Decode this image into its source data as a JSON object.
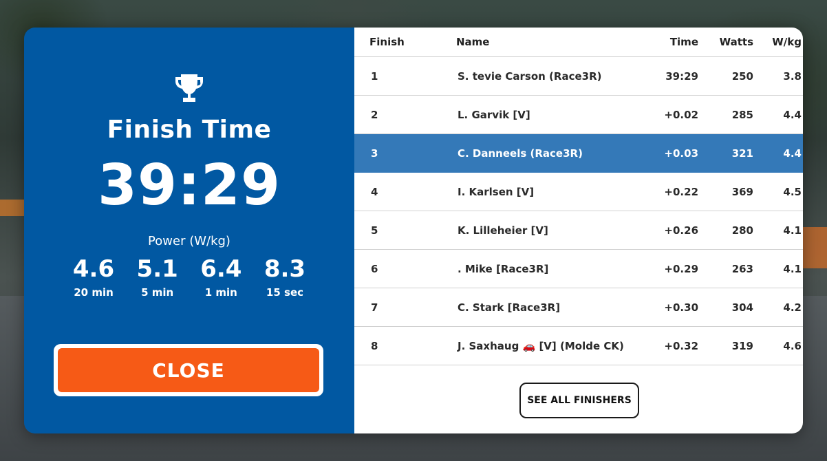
{
  "summary": {
    "title": "Finish Time",
    "time": "39:29",
    "power_label": "Power (W/kg)",
    "power": [
      {
        "value": "4.6",
        "period": "20 min"
      },
      {
        "value": "5.1",
        "period": "5 min"
      },
      {
        "value": "6.4",
        "period": "1 min"
      },
      {
        "value": "8.3",
        "period": "15 sec"
      }
    ],
    "close_label": "CLOSE"
  },
  "results": {
    "columns": {
      "finish": "Finish",
      "name": "Name",
      "time": "Time",
      "watts": "Watts",
      "wkg": "W/kg"
    },
    "rows": [
      {
        "finish": "1",
        "name": "S. tevie Carson (Race3R)",
        "time": "39:29",
        "watts": "250",
        "wkg": "3.8"
      },
      {
        "finish": "2",
        "name": "L. Garvik [V]",
        "time": "+0.02",
        "watts": "285",
        "wkg": "4.4"
      },
      {
        "finish": "3",
        "name": "C. Danneels (Race3R)",
        "time": "+0.03",
        "watts": "321",
        "wkg": "4.4"
      },
      {
        "finish": "4",
        "name": "I. Karlsen [V]",
        "time": "+0.22",
        "watts": "369",
        "wkg": "4.5"
      },
      {
        "finish": "5",
        "name": "K. Lilleheier [V]",
        "time": "+0.26",
        "watts": "280",
        "wkg": "4.1"
      },
      {
        "finish": "6",
        "name": " . Mike [Race3R]",
        "time": "+0.29",
        "watts": "263",
        "wkg": "4.1"
      },
      {
        "finish": "7",
        "name": "C. Stark [Race3R]",
        "time": "+0.30",
        "watts": "304",
        "wkg": "4.2"
      },
      {
        "finish": "8",
        "name": "J. Saxhaug 🚗 [V] (Molde CK)",
        "time": "+0.32",
        "watts": "319",
        "wkg": "4.6"
      }
    ],
    "highlighted_row": 2,
    "see_all_label": "SEE ALL FINISHERS"
  },
  "colors": {
    "panel_blue": "#0158a2",
    "highlight_blue": "#3479b8",
    "close_orange": "#f65a16"
  }
}
